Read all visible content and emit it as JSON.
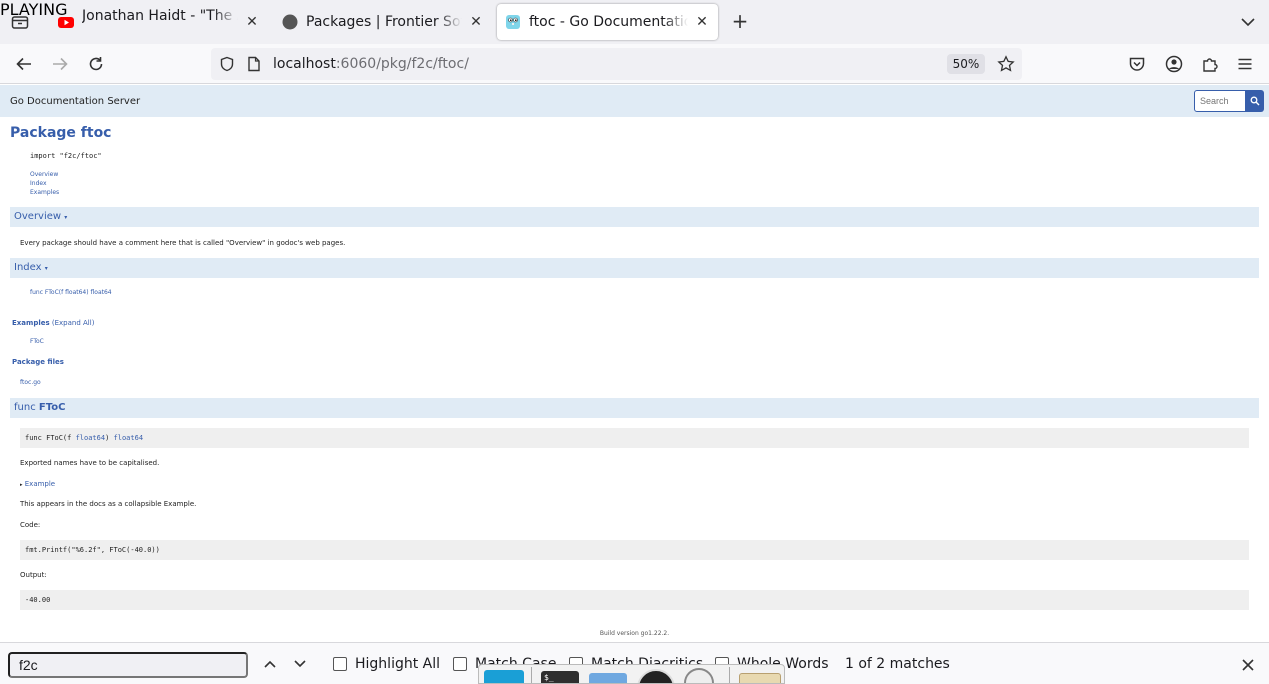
{
  "tabs": [
    {
      "title": "Jonathan Haidt - \"The Anxious Generation\"",
      "subtitle": "PLAYING",
      "icon": "youtube-icon",
      "active": false
    },
    {
      "title": "Packages | Frontier Software",
      "icon": "circle-icon",
      "active": false
    },
    {
      "title": "ftoc - Go Documentation Server",
      "icon": "gopher-icon",
      "active": true
    }
  ],
  "nav": {
    "url_host": "localhost",
    "url_path": ":6060/pkg/f2c/ftoc/",
    "zoom": "50%"
  },
  "page": {
    "brand": "Go Documentation Server",
    "search_placeholder": "Search",
    "title": "Package ftoc",
    "import_line": "import \"f2c/ftoc\"",
    "toc": [
      "Overview",
      "Index",
      "Examples"
    ],
    "overview_heading": "Overview",
    "overview_arrow": "▾",
    "overview_text": "Every package should have a comment here that is called \"Overview\" in godoc's web pages.",
    "index_heading": "Index",
    "index_arrow": "▾",
    "index_item": "func FToC(f float64) float64",
    "examples_label": "Examples",
    "expand_all": "(Expand All)",
    "example_item": "FToC",
    "package_files_label": "Package files",
    "file_item": "ftoc.go",
    "func_heading_prefix": "func",
    "func_heading_name": "FToC",
    "signature_prefix": "func FToC(f ",
    "signature_type1": "float64",
    "signature_mid": ") ",
    "signature_type2": "float64",
    "exported_text": "Exported names have to be capitalised.",
    "example_toggle_bullet": "▸",
    "example_toggle": "Example",
    "example_desc": "This appears in the docs as a collapsible Example.",
    "code_label": "Code:",
    "code": "fmt.Printf(\"%6.2f\", FToC(-40.0))",
    "output_label": "Output:",
    "output": "-40.00",
    "build_version": "Build version go1.22.2."
  },
  "findbar": {
    "query": "f2c",
    "highlight_all": "Highlight All",
    "match_case": "Match Case",
    "match_diacritics": "Match Diacritics",
    "whole_words": "Whole Words",
    "matches": "1 of 2 matches"
  },
  "colors": {
    "link": "#375eab",
    "section_bg": "#e0ebf5",
    "code_bg": "#efefef"
  }
}
